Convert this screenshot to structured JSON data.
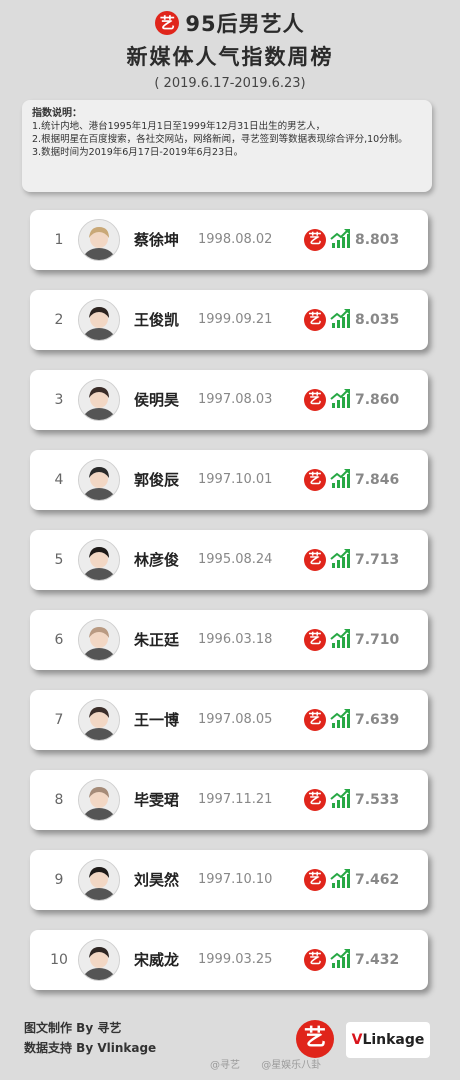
{
  "header": {
    "logo_glyph": "艺",
    "title_line1": "95后男艺人",
    "title_line2": "新媒体人气指数周榜",
    "date_range": "( 2019.6.17-2019.6.23)"
  },
  "notes": {
    "title": "指数说明：",
    "lines": [
      "1.统计内地、港台1995年1月1日至1999年12月31日出生的男艺人，",
      "2.根据明星在百度搜索，各社交网站，网络新闻，寻艺签到等数据表现综合评分,10分制。",
      "3.数据时间为2019年6月17日-2019年6月23日。"
    ]
  },
  "colors": {
    "brand_red": "#e0251b",
    "trend_green": "#27a845",
    "card_bg": "#ffffff",
    "page_bg": "#dcdcdc"
  },
  "ranking": [
    {
      "rank": "1",
      "name": "蔡徐坤",
      "birth": "1998.08.02",
      "score": "8.803"
    },
    {
      "rank": "2",
      "name": "王俊凯",
      "birth": "1999.09.21",
      "score": "8.035"
    },
    {
      "rank": "3",
      "name": "侯明昊",
      "birth": "1997.08.03",
      "score": "7.860"
    },
    {
      "rank": "4",
      "name": "郭俊辰",
      "birth": "1997.10.01",
      "score": "7.846"
    },
    {
      "rank": "5",
      "name": "林彦俊",
      "birth": "1995.08.24",
      "score": "7.713"
    },
    {
      "rank": "6",
      "name": "朱正廷",
      "birth": "1996.03.18",
      "score": "7.710"
    },
    {
      "rank": "7",
      "name": "王一博",
      "birth": "1997.08.05",
      "score": "7.639"
    },
    {
      "rank": "8",
      "name": "毕雯珺",
      "birth": "1997.11.21",
      "score": "7.533"
    },
    {
      "rank": "9",
      "name": "刘昊然",
      "birth": "1997.10.10",
      "score": "7.462"
    },
    {
      "rank": "10",
      "name": "宋威龙",
      "birth": "1999.03.25",
      "score": "7.432"
    }
  ],
  "icons": {
    "badge": "yi-logo-icon",
    "trend": "trend-up-icon",
    "avatar": "avatar-photo"
  },
  "footer": {
    "credit_1": "图文制作 By 寻艺",
    "credit_2": "数据支持 By Vlinkage",
    "logo_glyph": "艺",
    "vlinkage_v": "V",
    "vlinkage_rest": "Linkage",
    "watermark_1": "@寻艺",
    "watermark_2": "@星娱乐八卦"
  }
}
